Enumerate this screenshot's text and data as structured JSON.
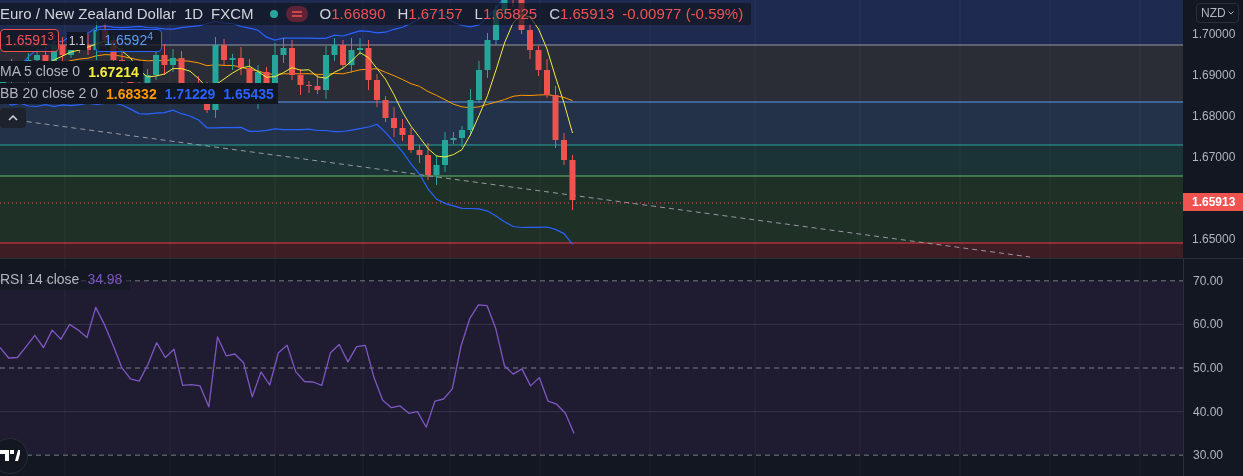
{
  "legend": {
    "symbol": "Euro / New Zealand Dollar",
    "interval": "1D",
    "exchange": "FXCM",
    "ohlc": [
      {
        "label": "O",
        "value": "1.66890"
      },
      {
        "label": "H",
        "value": "1.67157"
      },
      {
        "label": "L",
        "value": "1.65825"
      },
      {
        "label": "C",
        "value": "1.65913"
      }
    ],
    "change": "-0.00977 (-0.59%)"
  },
  "trade": {
    "sell": "1.6591$^{3}$",
    "spread": "1.1",
    "buy": "1.6592$^{4}$"
  },
  "indicators": [
    {
      "name": "MA 5 close 0",
      "values": [
        {
          "text": "1.67214",
          "color": "#f5eb3b"
        }
      ]
    },
    {
      "name": "BB 20 close 2 0",
      "values": [
        {
          "text": "1.68332",
          "color": "#ff9800"
        },
        {
          "text": "1.71229",
          "color": "#2962ff"
        },
        {
          "text": "1.65435",
          "color": "#2962ff"
        }
      ]
    }
  ],
  "price_axis": {
    "currency": "NZD",
    "ticks": [
      "1.70000",
      "1.69000",
      "1.68000",
      "1.67000",
      "1.65000"
    ],
    "last_price": "1.65913"
  },
  "rsi": {
    "value": "34.98",
    "chart_data": {
      "type": "line",
      "grid": true,
      "categories": [
        null,
        null,
        null,
        null,
        null,
        null,
        null,
        null,
        null,
        null,
        null,
        null,
        null,
        null,
        null,
        null,
        null,
        null,
        null,
        null,
        null,
        null,
        null,
        null,
        null,
        null,
        null,
        null,
        null,
        null,
        null,
        null,
        null,
        null,
        null,
        null,
        null,
        null,
        null,
        null,
        null,
        null,
        null,
        null,
        null,
        null,
        null,
        null,
        null,
        null,
        null,
        null,
        null,
        null,
        null,
        null,
        null,
        null,
        null,
        null,
        null,
        null,
        null,
        null,
        null,
        null,
        null,
        null,
        null,
        null,
        null,
        null,
        null,
        null,
        null,
        null,
        null,
        null,
        null,
        null,
        null,
        null,
        null,
        null,
        null,
        null,
        null,
        null,
        null,
        null,
        null,
        null,
        null,
        null,
        null,
        null,
        null,
        null,
        null,
        null,
        null,
        null,
        null,
        null,
        null,
        null,
        null,
        null,
        null,
        null,
        null,
        null,
        null,
        null,
        null,
        null,
        null,
        null,
        null,
        null,
        null,
        null,
        null,
        null,
        null,
        null,
        null,
        null,
        null,
        null,
        null,
        null,
        null,
        null,
        null,
        null,
        null
      ],
      "ylim": [
        25,
        75
      ],
      "yticks": [
        {
          "value": 70,
          "label": "70.00"
        },
        {
          "value": 60,
          "label": "60.00"
        },
        {
          "value": 50,
          "label": "50.00"
        },
        {
          "value": 40,
          "label": "40.00"
        },
        {
          "value": 30,
          "label": "30.00"
        }
      ],
      "series": [
        {
          "name": "RSI 14 close",
          "color": "#7e57c2",
          "values": [
            54.7,
            52.3,
            52.4,
            54.9,
            57.5,
            54.7,
            58.7,
            56.6,
            60.0,
            58.7,
            57.0,
            63.9,
            60.0,
            55.2,
            50.1,
            47.5,
            47.0,
            50.8,
            55.8,
            52.4,
            54.3,
            46.0,
            46.2,
            45.9,
            41.1,
            57.1,
            52.8,
            53.2,
            51.2,
            43.4,
            49.1,
            46.1,
            53.5,
            55.2,
            49.1,
            46.9,
            46.8,
            46.0,
            53.5,
            55.4,
            51.4,
            54.9,
            55.2,
            47.8,
            42.6,
            40.9,
            41.3,
            39.6,
            40.0,
            36.4,
            42.4,
            42.9,
            45.2,
            55.0,
            61.3,
            64.5,
            64.3,
            59.0,
            50.5,
            48.6,
            49.8,
            45.9,
            47.8,
            42.4,
            41.7,
            39.6,
            35.0,
            null,
            null,
            null,
            null,
            null,
            null,
            null,
            null,
            null,
            null,
            null,
            null,
            null,
            null,
            null,
            null,
            null,
            null,
            null,
            null,
            null,
            null,
            null,
            null,
            null,
            null,
            null,
            null,
            null,
            null,
            null,
            null,
            null,
            null,
            null,
            null,
            null,
            null,
            null,
            null,
            null,
            null,
            null,
            null,
            null,
            null,
            null,
            null,
            null,
            null,
            null,
            null,
            null,
            null,
            null,
            null,
            null,
            null,
            null,
            null,
            null,
            null,
            null,
            null,
            null,
            null,
            null,
            null,
            null,
            null
          ]
        }
      ]
    }
  }
}
